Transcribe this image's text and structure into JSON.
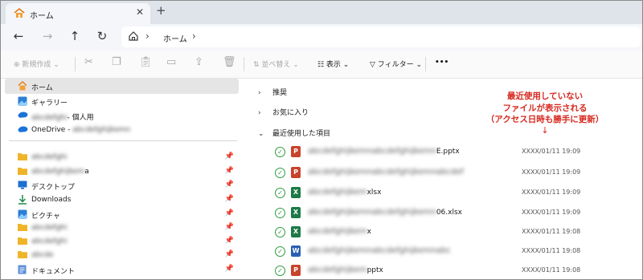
{
  "tab": {
    "title": "ホーム",
    "close": "✕",
    "new_tab": "+"
  },
  "nav": {
    "back": "←",
    "forward": "→",
    "up": "↑",
    "refresh": "↻",
    "sep": "›",
    "crumb": "ホーム"
  },
  "toolbar": {
    "new": "⊕ 新規作成 ⌄",
    "sort": "⇅ 並べ替え ⌄",
    "view": "☷ 表示 ⌄",
    "filter": "▽ フィルター ⌄",
    "more": "•••"
  },
  "sidebar": {
    "items": [
      {
        "label": "ホーム",
        "icon": "home-icon"
      },
      {
        "label": "ギャラリー",
        "icon": "gallery-icon"
      },
      {
        "label_blur": "abcdefghi",
        "label": "- 個人用",
        "icon": "onedrive-icon"
      },
      {
        "label": "OneDrive - ",
        "label_blur": "abcdefghijkemn",
        "icon": "onedrive-icon"
      },
      {
        "label_blur": "abcdefghi",
        "icon": "folder-icon"
      },
      {
        "label_blur": "abcdefghijkem",
        "label": "a",
        "icon": "folder-icon"
      },
      {
        "label": "デスクトップ",
        "icon": "desktop-icon"
      },
      {
        "label": "Downloads",
        "icon": "download-icon"
      },
      {
        "label": "ピクチャ",
        "icon": "pictures-icon"
      },
      {
        "label_blur": "abcdefghi",
        "icon": "folder-icon"
      },
      {
        "label_blur": "abcdefghi",
        "icon": "folder-icon"
      },
      {
        "label_blur": "abcde",
        "icon": "folder-icon"
      },
      {
        "label": "ドキュメント",
        "icon": "documents-icon"
      }
    ],
    "pin": "📌"
  },
  "content": {
    "sections": {
      "recommended": "推奨",
      "favorites": "お気に入り",
      "recent": "最近使用した項目"
    },
    "chevrons": {
      "right": "›",
      "down": "⌄"
    },
    "files": [
      {
        "type": "ppt",
        "badge": "P",
        "name_blur": "abcdefghijkemnabcdefghijkemn",
        "ext": "E.pptx",
        "date": "XXXX/01/11 19:09"
      },
      {
        "type": "ppt",
        "badge": "P",
        "name_blur": "abcdefghijkemnabcdefghijkemnabcdef",
        "ext": "",
        "date": "XXXX/01/11 19:09"
      },
      {
        "type": "xls",
        "badge": "X",
        "name_blur": "abcdefghijkem",
        "ext": "xlsx",
        "date": "XXXX/01/11 19:09"
      },
      {
        "type": "xls",
        "badge": "X",
        "name_blur": "abcdefghijkemnabcdefghijkemn",
        "ext": "06.xlsx",
        "date": "XXXX/01/11 19:09"
      },
      {
        "type": "xls",
        "badge": "X",
        "name_blur": "abcdefghijkem",
        "ext": "x",
        "date": "XXXX/01/11 19:08"
      },
      {
        "type": "doc",
        "badge": "W",
        "name_blur": "abcdefghijkemnabcdefghijkemnabc",
        "ext": "",
        "date": "XXXX/01/11 19:08"
      },
      {
        "type": "ppt",
        "badge": "P",
        "name_blur": "abcdefghijkem",
        "ext": "pptx",
        "date": "XXXX/01/11 19:08"
      }
    ]
  },
  "annotation": {
    "line1": "最近使用していない",
    "line2": "ファイルが表示される",
    "line3": "（アクセス日時も勝手に更新）",
    "arrow": "↓"
  }
}
